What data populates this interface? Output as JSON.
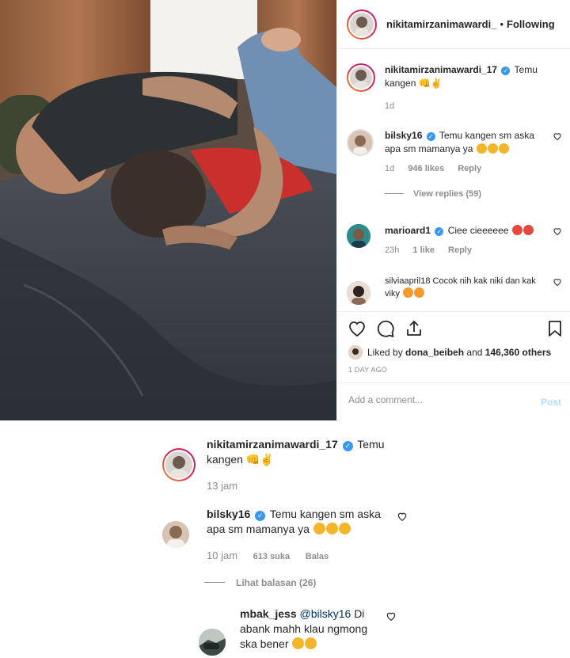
{
  "post": {
    "header": {
      "username": "nikitamirzanimawardi_",
      "separator": "•",
      "follow_status": "Following"
    },
    "comments": [
      {
        "username": "nikitamirzanimawardi_17",
        "verified": true,
        "text": "Temu kangen",
        "emoji": "👊✌",
        "time": "1d"
      },
      {
        "username": "bilsky16",
        "verified": true,
        "text": "Temu kangen sm aska apa sm mamanya ya",
        "time": "1d",
        "likes": "946 likes",
        "reply": "Reply"
      },
      {
        "username": "marioard1",
        "verified": true,
        "text": "Ciee cieeeeee",
        "time": "23h",
        "likes": "1 like",
        "reply": "Reply"
      },
      {
        "username": "silviaapril18",
        "verified": false,
        "text": "Cocok nih kak niki dan kak viky"
      }
    ],
    "view_replies": "View replies (59)",
    "liked_by": {
      "prefix": "Liked by",
      "user": "dona_beibeh",
      "conj": "and",
      "others": "146,360 others"
    },
    "time_ago": "1 DAY AGO",
    "add_comment_placeholder": "Add a comment...",
    "post_button": "Post",
    "icons": [
      "heart-icon",
      "comment-icon",
      "share-icon",
      "bookmark-icon"
    ]
  },
  "mobile": {
    "comments": [
      {
        "username": "nikitamirzanimawardi_17",
        "verified": true,
        "text": "Temu kangen",
        "time": "13 jam"
      },
      {
        "username": "bilsky16",
        "verified": true,
        "text": "Temu kangen sm aska apa sm mamanya ya",
        "time": "10 jam",
        "likes": "613 suka",
        "reply": "Balas"
      },
      {
        "username": "mbak_jess",
        "verified": false,
        "mention": "@bilsky16",
        "text": "Di abank mahh klau ngmong ska bener"
      }
    ],
    "view_replies": "Lihat balasan (26)"
  },
  "colors": {
    "link": "#003569",
    "verified": "#3897f0",
    "muted": "#8e8e8e",
    "post_disabled": "#b2dffc"
  }
}
